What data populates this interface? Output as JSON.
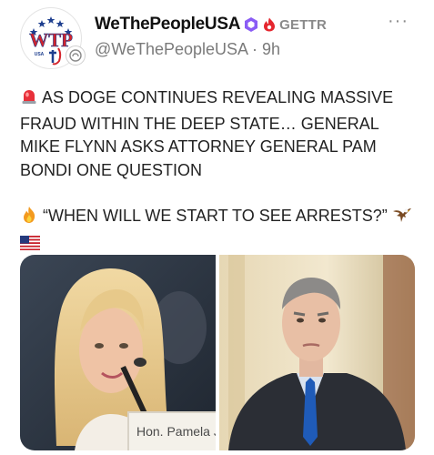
{
  "post": {
    "author": {
      "display_name": "WeThePeopleUSA",
      "handle_line": "@WeThePeopleUSA · 9h",
      "platform": "GETTR",
      "avatar_text": "WTP",
      "avatar_subtext": "USA",
      "icons": [
        "verified-badge-icon",
        "gettr-flame-icon",
        "more-options-icon"
      ]
    },
    "more_label": "···",
    "body": {
      "paragraph1": "AS DOGE CONTINUES REVEALING MASSIVE FRAUD WITHIN THE DEEP STATE… GENERAL MIKE FLYNN ASKS ATTORNEY GENERAL PAM BONDI ONE QUESTION",
      "paragraph2": "“WHEN WILL WE START TO SEE ARRESTS?”",
      "emojis": [
        "police-light-emoji",
        "fire-emoji",
        "eagle-emoji",
        "us-flag-emoji"
      ]
    },
    "media": {
      "left_caption": "Hon. Pamela Jo"
    }
  },
  "colors": {
    "platform_red": "#e5262e",
    "verified_purple": "#8a5cf5",
    "text": "#222222",
    "muted": "#7a7a7a"
  }
}
